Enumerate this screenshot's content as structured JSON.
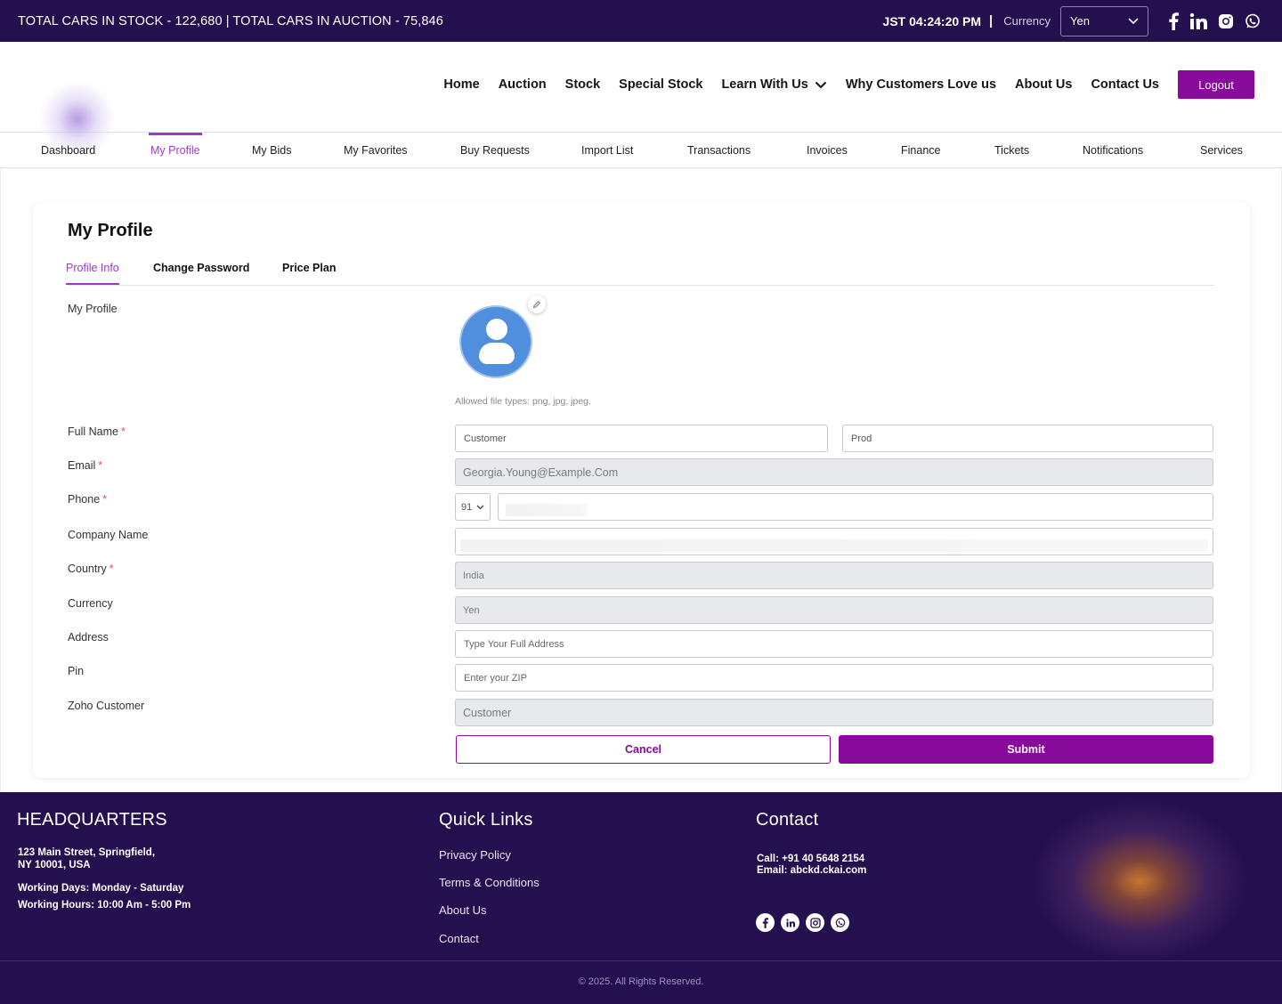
{
  "topbar": {
    "stock_text": "TOTAL CARS IN STOCK - 122,680 | TOTAL CARS IN AUCTION - 75,846",
    "time": "JST 04:24:20 PM",
    "separator": "|",
    "currency_label": "Currency",
    "currency_value": "Yen",
    "social_icons": [
      "facebook-icon",
      "linkedin-icon",
      "instagram-icon",
      "whatsapp-icon"
    ]
  },
  "nav": {
    "items": [
      "Home",
      "Auction",
      "Stock",
      "Special Stock",
      "Learn With Us",
      "Why Customers Love us",
      "About Us",
      "Contact Us"
    ],
    "logout": "Logout"
  },
  "subnav": {
    "items": [
      "Dashboard",
      "My Profile",
      "My Bids",
      "My Favorites",
      "Buy Requests",
      "Import List",
      "Transactions",
      "Invoices",
      "Finance",
      "Tickets",
      "Notifications",
      "Services"
    ],
    "active": "My Profile"
  },
  "profile": {
    "title": "My Profile",
    "tabs": [
      "Profile Info",
      "Change Password",
      "Price Plan"
    ],
    "active_tab": "Profile Info",
    "avatar_label": "My Profile",
    "allowed_types": "Allowed file types: png, jpg, jpeg.",
    "labels": {
      "full_name": "Full Name",
      "email": "Email",
      "phone": "Phone",
      "company": "Company Name",
      "country": "Country",
      "currency": "Currency",
      "address": "Address",
      "pin": "Pin",
      "zoho": "Zoho Customer"
    },
    "required_mark": "*",
    "values": {
      "first_name": "Customer",
      "last_name": "Prod",
      "email": "Georgia.Young@Example.Com",
      "phone_code": "91",
      "country": "India",
      "currency": "Yen",
      "zoho": "Customer"
    },
    "placeholders": {
      "address": "Type Your Full Address",
      "pin": "Enter your ZIP"
    },
    "cancel": "Cancel",
    "submit": "Submit"
  },
  "footer": {
    "hq_title": "HEADQUARTERS",
    "address_line1": "123 Main Street, Springfield,",
    "address_line2": "NY 10001, USA",
    "working_days": "Working Days: Monday - Saturday",
    "working_hours": "Working Hours: 10:00 Am - 5:00 Pm",
    "links_title": "Quick Links",
    "links": [
      "Privacy Policy",
      "Terms & Conditions",
      "About Us",
      "Contact"
    ],
    "contact_title": "Contact",
    "call": "Call: +91 40 5648 2154",
    "email": "Email: abckd.ckai.com",
    "copyright": "© 2025. All Rights Reserved."
  },
  "colors": {
    "brand_dark": "#24104f",
    "accent": "#880a9a",
    "active_tab": "#9d3bc3"
  }
}
